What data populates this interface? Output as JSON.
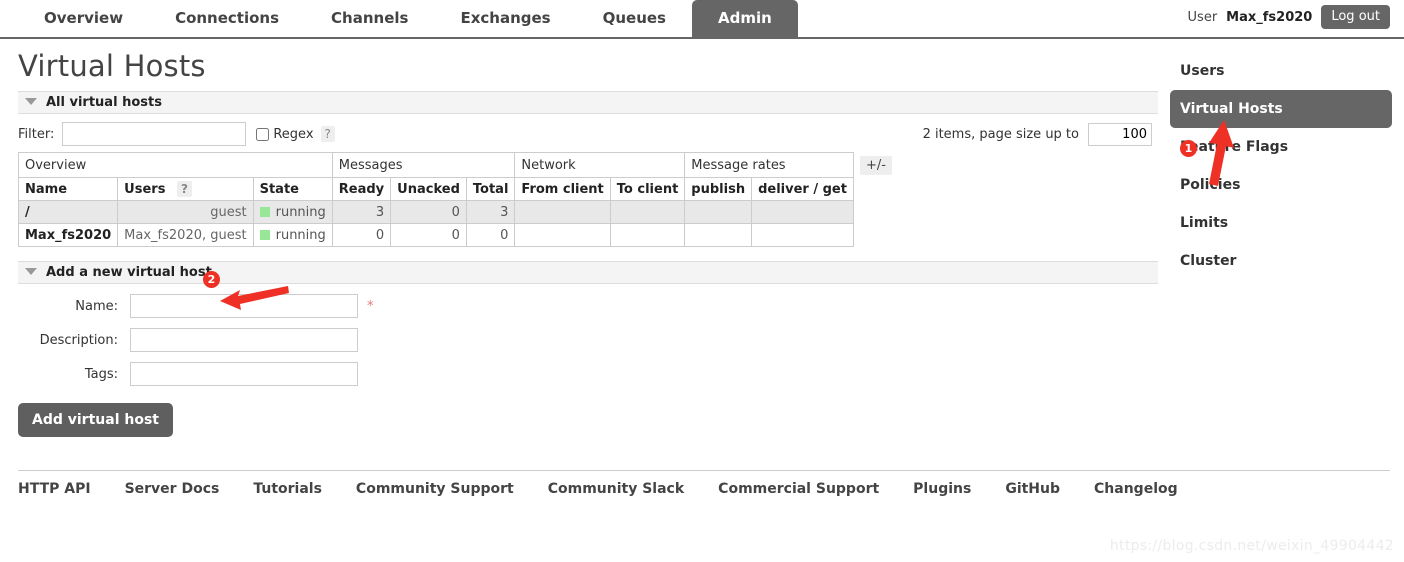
{
  "nav": {
    "tabs": [
      {
        "label": "Overview",
        "active": false
      },
      {
        "label": "Connections",
        "active": false
      },
      {
        "label": "Channels",
        "active": false
      },
      {
        "label": "Exchanges",
        "active": false
      },
      {
        "label": "Queues",
        "active": false
      },
      {
        "label": "Admin",
        "active": true
      }
    ],
    "user_prefix": "User",
    "user_name": "Max_fs2020",
    "logout_label": "Log out"
  },
  "page": {
    "title": "Virtual Hosts"
  },
  "all_vhosts_section": {
    "heading": "All virtual hosts",
    "filter_label": "Filter:",
    "filter_value": "",
    "regex_label": "Regex",
    "help_mark": "?",
    "pager_text": "2 items, page size up to",
    "page_size": "100"
  },
  "table": {
    "group_headers": [
      {
        "label": "Overview",
        "span": 3
      },
      {
        "label": "Messages",
        "span": 3
      },
      {
        "label": "Network",
        "span": 2
      },
      {
        "label": "Message rates",
        "span": 2
      }
    ],
    "columns": [
      {
        "label": "Name",
        "align": "l"
      },
      {
        "label": "Users",
        "align": "l",
        "help": "?"
      },
      {
        "label": "State",
        "align": "l"
      },
      {
        "label": "Ready",
        "align": "r"
      },
      {
        "label": "Unacked",
        "align": "r"
      },
      {
        "label": "Total",
        "align": "r"
      },
      {
        "label": "From client",
        "align": "l"
      },
      {
        "label": "To client",
        "align": "l"
      },
      {
        "label": "publish",
        "align": "l"
      },
      {
        "label": "deliver / get",
        "align": "l"
      }
    ],
    "toggle_columns_label": "+/-",
    "rows": [
      {
        "name": "/",
        "users": "guest",
        "state": "running",
        "state_color": "#98e698",
        "ready": "3",
        "unacked": "0",
        "total": "3",
        "from_client": "",
        "to_client": "",
        "publish": "",
        "deliver_get": ""
      },
      {
        "name": "Max_fs2020",
        "users": "Max_fs2020, guest",
        "state": "running",
        "state_color": "#98e698",
        "ready": "0",
        "unacked": "0",
        "total": "0",
        "from_client": "",
        "to_client": "",
        "publish": "",
        "deliver_get": ""
      }
    ]
  },
  "add_vhost_section": {
    "heading": "Add a new virtual host",
    "name_label": "Name:",
    "name_value": "",
    "required_mark": "*",
    "description_label": "Description:",
    "description_value": "",
    "tags_label": "Tags:",
    "tags_value": "",
    "submit_label": "Add virtual host"
  },
  "sidebar": {
    "items": [
      {
        "label": "Users",
        "active": false
      },
      {
        "label": "Virtual Hosts",
        "active": true
      },
      {
        "label": "Feature Flags",
        "active": false
      },
      {
        "label": "Policies",
        "active": false
      },
      {
        "label": "Limits",
        "active": false
      },
      {
        "label": "Cluster",
        "active": false
      }
    ]
  },
  "footer": {
    "links": [
      "HTTP API",
      "Server Docs",
      "Tutorials",
      "Community Support",
      "Community Slack",
      "Commercial Support",
      "Plugins",
      "GitHub",
      "Changelog"
    ]
  },
  "annotations": [
    {
      "number": "1",
      "target": "sidebar-item-virtual-hosts"
    },
    {
      "number": "2",
      "target": "add-vhost-section-heading"
    }
  ],
  "watermark": "https://blog.csdn.net/weixin_49904442",
  "colors": {
    "accent": "#666666",
    "annotation": "#ee3124",
    "running": "#98e698",
    "required": "#e27878"
  }
}
